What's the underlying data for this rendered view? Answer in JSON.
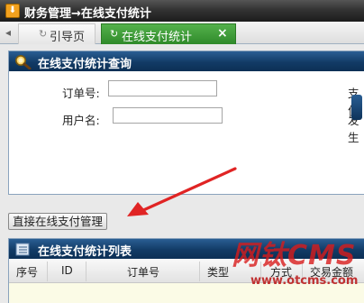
{
  "window": {
    "title": "财务管理→在线支付统计",
    "title_icon": "arrow-down-icon"
  },
  "tabs": [
    {
      "label": "引导页",
      "icon": "refresh-icon",
      "active": false
    },
    {
      "label": "在线支付统计",
      "icon": "refresh-icon",
      "active": true,
      "close_symbol": "×"
    }
  ],
  "tab_prev_symbol": "◂",
  "query_panel": {
    "title": "在线支付统计查询",
    "icon": "magnifier-icon",
    "fields": [
      {
        "label": "订单号:",
        "value": "",
        "placeholder": ""
      },
      {
        "label": "用户名:",
        "value": "",
        "placeholder": ""
      }
    ],
    "right_labels": [
      "支付",
      "发生"
    ]
  },
  "management_button": {
    "label": "直接在线支付管理"
  },
  "list_panel": {
    "title": "在线支付统计列表",
    "icon": "list-icon",
    "columns": [
      "序号",
      "ID",
      "订单号",
      "类型",
      "方式",
      "交易金额"
    ]
  },
  "watermark": {
    "main": "网钛CMS",
    "sub": "www.otcms.com"
  },
  "colors": {
    "panel_header": "#123b66",
    "active_tab": "#3f9c38",
    "arrow": "#e02424",
    "watermark": "#d81c1c"
  }
}
